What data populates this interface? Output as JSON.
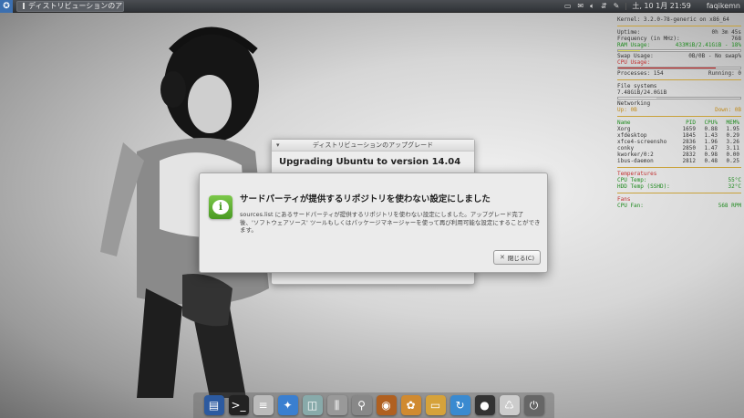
{
  "top_panel": {
    "menu_icon": "xfce-menu-icon",
    "task_title": "ディストリビューションのアップ…",
    "tray_icons": [
      "battery-icon",
      "mail-icon",
      "volume-icon",
      "network-icon",
      "screenshot-icon"
    ],
    "clock": "土, 10 1月 21:59",
    "user": "faqikemn"
  },
  "conky": {
    "header": "Kernel: 3.2.0-78-generic on x86_64",
    "uptime": {
      "label": "Uptime:",
      "value": "0h 3m 45s"
    },
    "freq": {
      "label": "Frequency (in MHz):",
      "value": "768"
    },
    "ram": {
      "label": "RAM Usage:",
      "value": "433MiB/2.41GiB - 18%",
      "pct": 18
    },
    "swap": {
      "label": "Swap Usage:",
      "value": "0B/0B - No swap%",
      "pct": 0
    },
    "cpu": {
      "label": "CPU Usage:",
      "pct": 80
    },
    "processes": {
      "label": "Processes:",
      "value": "154",
      "running_label": "Running:",
      "running": "0"
    },
    "fs": {
      "label": "File systems",
      "value": "7.48GiB/24.0GiB",
      "pct": 31
    },
    "network": {
      "label": "Networking",
      "up_label": "Up:",
      "up": "0B",
      "down_label": "Down:",
      "down": "0B"
    },
    "proc_header": [
      "Name",
      "PID",
      "CPU%",
      "MEM%"
    ],
    "procs": [
      [
        "Xorg",
        "1659",
        "0.88",
        "1.95"
      ],
      [
        "xfdesktop",
        "1845",
        "1.43",
        "0.29"
      ],
      [
        "xfce4-screensho",
        "2836",
        "1.96",
        "3.26"
      ],
      [
        "conky",
        "2850",
        "1.47",
        "3.11"
      ],
      [
        "kworker/0:2",
        "2832",
        "0.98",
        "0.00"
      ],
      [
        "ibus-daemon",
        "2812",
        "0.48",
        "0.25"
      ]
    ],
    "temps_header": "Temperatures",
    "temp_rows": [
      {
        "label": "CPU Temp:",
        "value": "55°C"
      },
      {
        "label": "HDD Temp (SSHD):",
        "value": "32°C"
      }
    ],
    "fan_header": "Fans",
    "fan": {
      "label": "CPU Fan:",
      "value": "568 RPM"
    }
  },
  "back_dialog": {
    "title": "ディストリビューションのアップグレード",
    "heading": "Upgrading Ubuntu to version 14.04"
  },
  "front_dialog": {
    "title": "サードパーティが提供するリポジトリを使わない設定にしました",
    "message": "sources.list にあるサードパーティが提供するリポジトリを使わない設定にしました。アップグレード完了後、'ソフトウェアソース' ツールもしくはパッケージマネージャーを使って再び利用可能な設定にすることができます。",
    "close_label": "閉じる(C)"
  },
  "dock": [
    {
      "name": "desktop-icon",
      "glyph": "▤",
      "color": "#2c5aa0"
    },
    {
      "name": "terminal-icon",
      "glyph": ">_",
      "color": "#222"
    },
    {
      "name": "file-manager-icon",
      "glyph": "≡",
      "color": "#bbb"
    },
    {
      "name": "safari-icon",
      "glyph": "✦",
      "color": "#3a7fd0"
    },
    {
      "name": "system-monitor-icon",
      "glyph": "◫",
      "color": "#8aa"
    },
    {
      "name": "mixer-icon",
      "glyph": "⫼",
      "color": "#999"
    },
    {
      "name": "search-icon",
      "glyph": "⚲",
      "color": "#888"
    },
    {
      "name": "media-icon",
      "glyph": "◉",
      "color": "#b06020"
    },
    {
      "name": "photos-icon",
      "glyph": "✿",
      "color": "#d08a30"
    },
    {
      "name": "folder-icon",
      "glyph": "▭",
      "color": "#d6a23a"
    },
    {
      "name": "update-icon",
      "glyph": "↻",
      "color": "#3a8ad0"
    },
    {
      "name": "recorder-icon",
      "glyph": "●",
      "color": "#333"
    },
    {
      "name": "trash-icon",
      "glyph": "♺",
      "color": "#ccc"
    },
    {
      "name": "shutdown-icon",
      "glyph": "⏻",
      "color": "#666"
    }
  ]
}
